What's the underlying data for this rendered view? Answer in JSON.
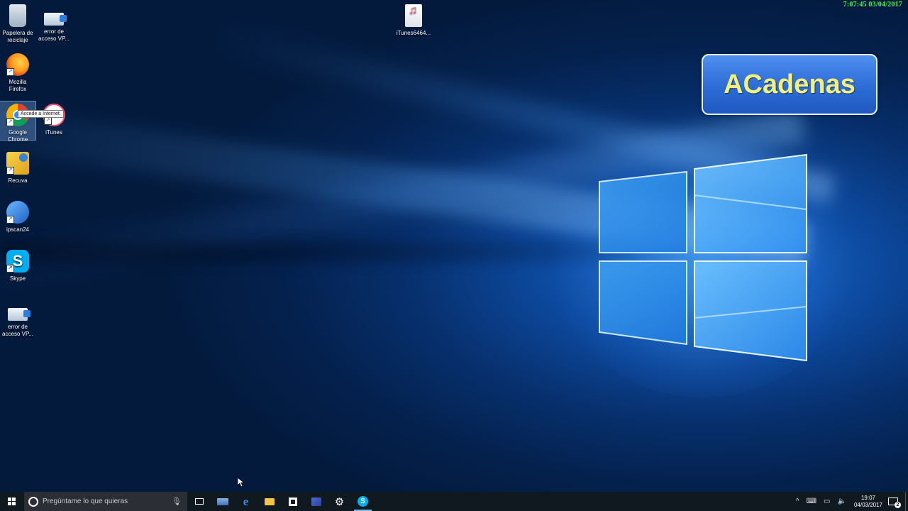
{
  "desktop": {
    "icons": [
      {
        "label_line1": "Papelera de",
        "label_line2": "reciclaje"
      },
      {
        "label_line1": "error de",
        "label_line2": "acceso VP..."
      },
      {
        "label_line1": "Mozilla",
        "label_line2": "Firefox"
      },
      {
        "label_line1": "Google",
        "label_line2": "Chrome"
      },
      {
        "label_line1": "iTunes",
        "label_line2": ""
      },
      {
        "label_line1": "Recuva",
        "label_line2": ""
      },
      {
        "label_line1": "ipscan24",
        "label_line2": ""
      },
      {
        "label_line1": "Skype",
        "label_line2": ""
      },
      {
        "label_line1": "error de",
        "label_line2": "acceso VP..."
      },
      {
        "label_line1": "iTunes6464...",
        "label_line2": ""
      }
    ],
    "tooltip": "Accede a Internet.",
    "skype_glyph": "S"
  },
  "overlay": {
    "recording_clock": "7:07:45  03/04/2017",
    "watermark": "ACadenas"
  },
  "taskbar": {
    "search_placeholder": "Pregúntame lo que quieras",
    "edge_glyph": "e",
    "settings_glyph": "⚙",
    "skype_glyph": "S",
    "tray": {
      "chevron": "^",
      "time": "19:07",
      "date": "04/03/2017",
      "notification_count": "2"
    }
  },
  "colors": {
    "overlay_clock": "#3cff3c",
    "watermark_text": "#f2f07a",
    "watermark_bg": "#2f6fd8",
    "taskbar_bg": "#101820",
    "active_indicator": "#76b9ed"
  }
}
